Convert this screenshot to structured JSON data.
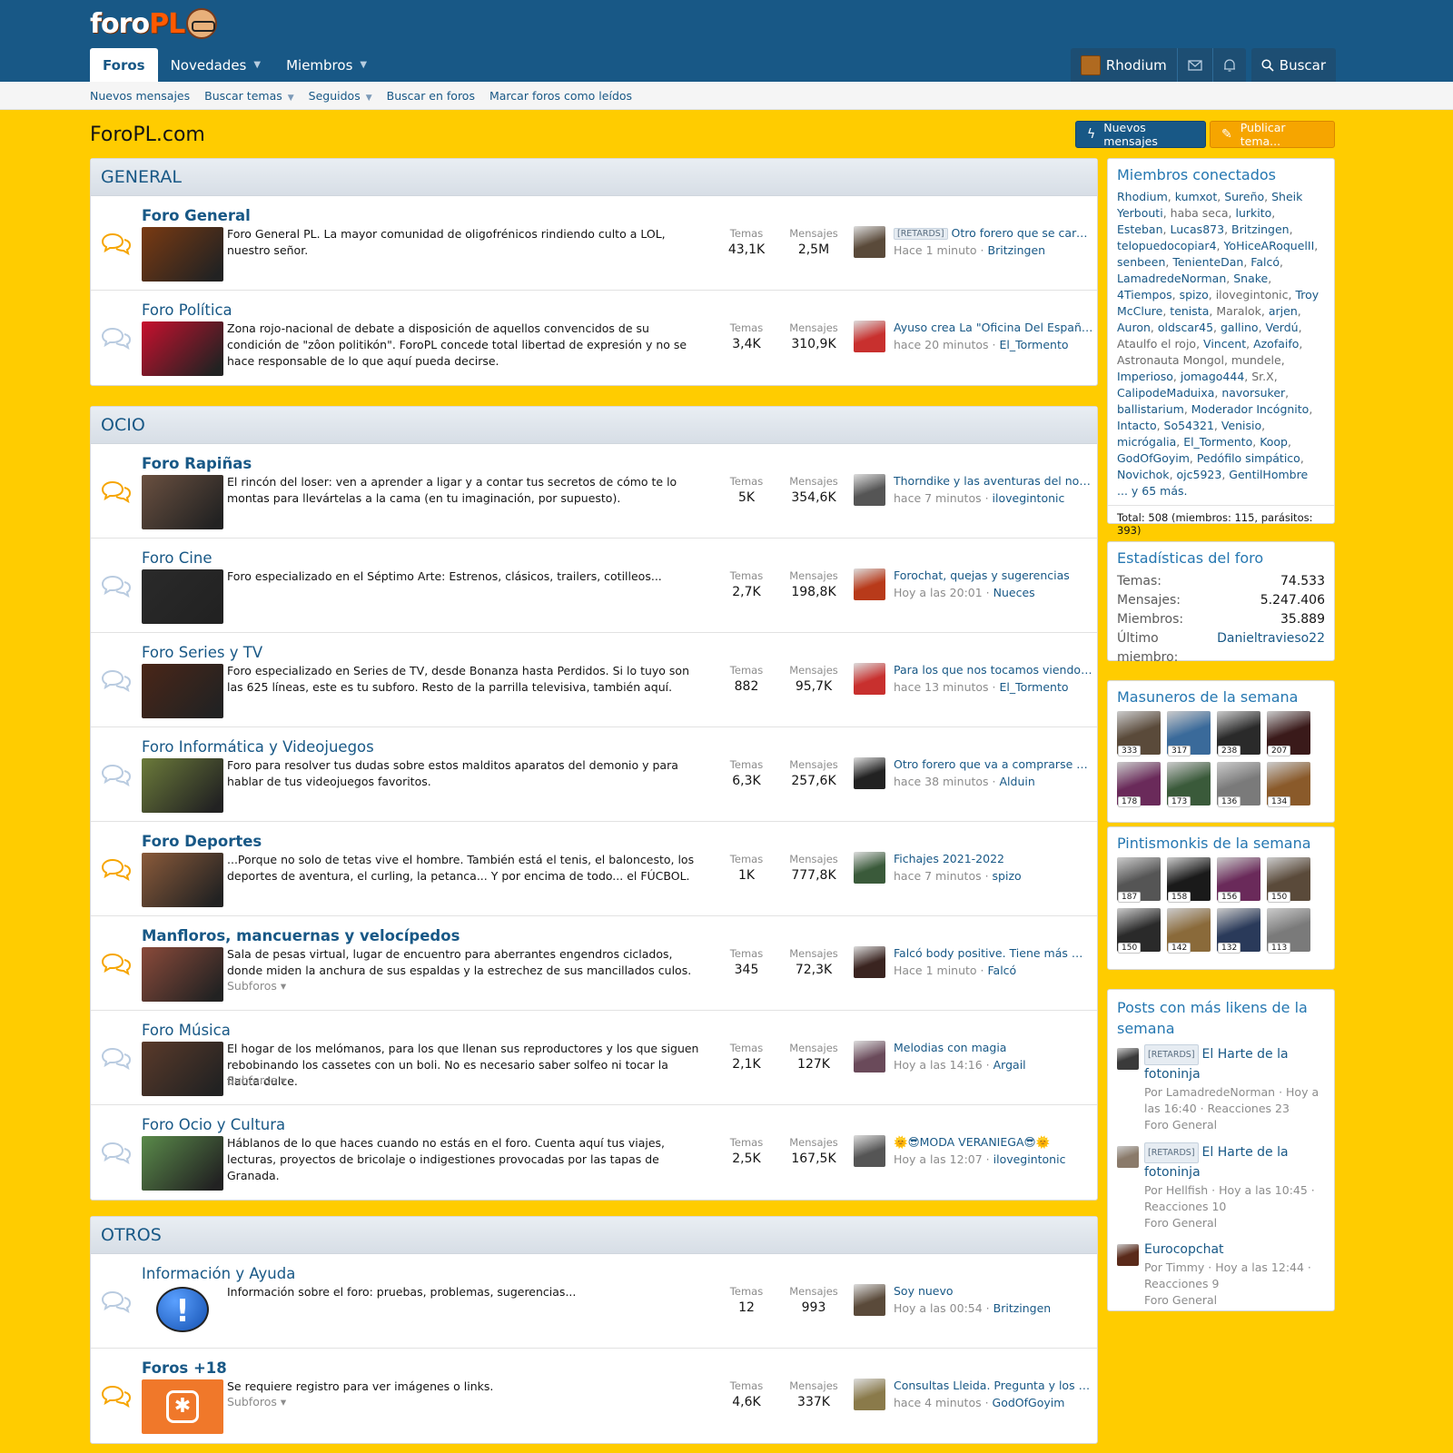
{
  "logo": {
    "part1": "foro",
    "part2": "PL"
  },
  "nav": {
    "tabs": [
      {
        "label": "Foros",
        "active": true
      },
      {
        "label": "Novedades",
        "caret": true
      },
      {
        "label": "Miembros",
        "caret": true
      }
    ],
    "user": "Rhodium",
    "search_label": "Buscar"
  },
  "subnav": [
    "Nuevos mensajes",
    "Buscar temas",
    "Seguidos",
    "Buscar en foros",
    "Marcar foros como leídos"
  ],
  "page_title": "ForoPL.com",
  "buttons": {
    "new_posts": "Nuevos mensajes",
    "post_thread": "Publicar tema..."
  },
  "labels": {
    "threads": "Temas",
    "messages": "Mensajes",
    "subforums": "Subforos"
  },
  "categories": [
    {
      "title": "GENERAL",
      "nodes": [
        {
          "name": "Foro General",
          "unread": true,
          "thumb": "#7a3a12",
          "desc": "Foro General PL. La mayor comunidad de oligofrénicos rindiendo culto a LOL, nuestro señor.",
          "threads": "43,1K",
          "messages": "2,5M",
          "last_prefix": "[RETARDS]",
          "last_title": "Otro forero que se carga en el hilo para",
          "last_time": "Hace 1 minuto",
          "last_user": "Britzingen",
          "last_av": "#5a4a3a"
        },
        {
          "name": "Foro Política",
          "unread": false,
          "thumb": "#c8102e",
          "desc": "Zona rojo-nacional de debate a disposición de aquellos convencidos de su condición de \"zôon politikón\". ForoPL concede total libertad de expresión y no se hace responsable de lo que aquí pueda decirse.",
          "threads": "3,4K",
          "messages": "310,9K",
          "last_prefix": "",
          "last_title": "Ayuso crea La \"Oficina Del Español\" para",
          "last_time": "hace 20 minutos",
          "last_user": "El_Tormento",
          "last_av": "#c8302e"
        }
      ]
    },
    {
      "title": "OCIO",
      "nodes": [
        {
          "name": "Foro Rapiñas",
          "unread": true,
          "thumb": "#6a5040",
          "desc": "El rincón del loser: ven a aprender a ligar y a contar tus secretos de cómo te lo montas para llevártelas a la cama (en tu imaginación, por supuesto).",
          "threads": "5K",
          "messages": "354,6K",
          "last_prefix": "",
          "last_title": "Thorndike y las aventuras del no pasa nada",
          "last_time": "hace 7 minutos",
          "last_user": "ilovegintonic",
          "last_av": "#555555"
        },
        {
          "name": "Foro Cine",
          "unread": false,
          "thumb": "#2a2a2a",
          "desc": "Foro especializado en el Séptimo Arte: Estrenos, clásicos, trailers, cotilleos...",
          "threads": "2,7K",
          "messages": "198,8K",
          "last_prefix": "",
          "last_title": "Forochat, quejas y sugerencias",
          "last_time": "Hoy a las 20:01",
          "last_user": "Nueces",
          "last_av": "#b83a1a"
        },
        {
          "name": "Foro Series y TV",
          "unread": false,
          "thumb": "#4a2618",
          "desc": "Foro especializado en Series de TV, desde Bonanza hasta Perdidos. Si lo tuyo son las 625 líneas, este es tu subforo. Resto de la parrilla televisiva, también aquí.",
          "threads": "882",
          "messages": "95,7K",
          "last_prefix": "",
          "last_title": "Para los que nos tocamos viendo digimon",
          "last_time": "hace 13 minutos",
          "last_user": "El_Tormento",
          "last_av": "#c8302e"
        },
        {
          "name": "Foro Informática y Videojuegos",
          "unread": false,
          "thumb": "#6b7a3a",
          "desc": "Foro para resolver tus dudas sobre estos malditos aparatos del demonio y para hablar de tus videojuegos favoritos.",
          "threads": "6,3K",
          "messages": "257,6K",
          "last_prefix": "",
          "last_title": "Otro forero que va a comprarse un PC",
          "last_time": "hace 38 minutos",
          "last_user": "Alduin",
          "last_av": "#222222"
        },
        {
          "name": "Foro Deportes",
          "unread": true,
          "thumb": "#8a5a3a",
          "desc": "...Porque no solo de tetas vive el hombre. También está el tenis, el baloncesto, los deportes de aventura, el curling, la petanca... Y por encima de todo... el FÚCBOL.",
          "threads": "1K",
          "messages": "777,8K",
          "last_prefix": "",
          "last_title": "Fichajes 2021-2022",
          "last_time": "hace 7 minutos",
          "last_user": "spizo",
          "last_av": "#3a5a3a"
        },
        {
          "name": "Manfloros, mancuernas y velocípedos",
          "unread": true,
          "thumb": "#8a4a3a",
          "desc": "Sala de pesas virtual, lugar de encuentro para aberrantes engendros ciclados, donde miden la anchura de sus espaldas y la estrechez de sus mancillados culos.",
          "threads": "345",
          "messages": "72,3K",
          "subforos": true,
          "last_prefix": "",
          "last_title": "Falcó body positive. Tiene más mortales que",
          "last_time": "Hace 1 minuto",
          "last_user": "Falcó",
          "last_av": "#3a2420"
        },
        {
          "name": "Foro Música",
          "unread": false,
          "thumb": "#5a3a2a",
          "desc": "El hogar de los melómanos, para los que llenan sus reproductores y los que siguen rebobinando los cassetes con un boli. No es necesario saber solfeo ni tocar la flauta dulce.",
          "threads": "2,1K",
          "messages": "127K",
          "subforos": true,
          "last_prefix": "",
          "last_title": "Melodias con magia",
          "last_time": "Hoy a las 14:16",
          "last_user": "Argail",
          "last_av": "#6a4a5a"
        },
        {
          "name": "Foro Ocio y Cultura",
          "unread": false,
          "thumb": "#5a8a4a",
          "desc": "Háblanos de lo que haces cuando no estás en el foro. Cuenta aquí tus viajes, lecturas, proyectos de bricolaje o indigestiones provocadas por las tapas de Granada.",
          "threads": "2,5K",
          "messages": "167,5K",
          "last_prefix": "",
          "last_title": "🌞😎MODA VERANIEGA😎🌞",
          "last_time": "Hoy a las 12:07",
          "last_user": "ilovegintonic",
          "last_av": "#555555"
        }
      ]
    },
    {
      "title": "OTROS",
      "nodes": [
        {
          "name": "Información y Ayuda",
          "unread": false,
          "thumb": "#ffcc00",
          "thumb_icon": "!",
          "desc": "Información sobre el foro: pruebas, problemas, sugerencias...",
          "threads": "12",
          "messages": "993",
          "last_prefix": "",
          "last_title": "Soy nuevo",
          "last_time": "Hoy a las 00:54",
          "last_user": "Britzingen",
          "last_av": "#5a4a3a"
        },
        {
          "name": "Foros +18",
          "unread": true,
          "thumb": "#f0782a",
          "desc": "Se requiere registro para ver imágenes o links.",
          "threads": "4,6K",
          "messages": "337K",
          "subforos": true,
          "last_prefix": "",
          "last_title": "Consultas Lleida. Pregunta y los foreros",
          "last_time": "hace 4 minutos",
          "last_user": "GodOfGoyim",
          "last_av": "#8a7a4a"
        }
      ]
    }
  ],
  "online": {
    "title": "Miembros conectados",
    "members": [
      {
        "n": "Rhodium",
        "g": false
      },
      {
        "n": "kumxot",
        "g": false
      },
      {
        "n": "Sureño",
        "g": false
      },
      {
        "n": "Sheik Yerbouti",
        "g": false
      },
      {
        "n": "haba seca",
        "g": true
      },
      {
        "n": "lurkito",
        "g": false
      },
      {
        "n": "Esteban",
        "g": false
      },
      {
        "n": "Lucas873",
        "g": false
      },
      {
        "n": "Britzingen",
        "g": false
      },
      {
        "n": "telopuedocopiar4",
        "g": false
      },
      {
        "n": "YoHiceARoquelII",
        "g": false
      },
      {
        "n": "senbeen",
        "g": false
      },
      {
        "n": "TenienteDan",
        "g": false
      },
      {
        "n": "Falcó",
        "g": false
      },
      {
        "n": "LamadredeNorman",
        "g": false
      },
      {
        "n": "Snake",
        "g": false
      },
      {
        "n": "4Tiempos",
        "g": false
      },
      {
        "n": "spizo",
        "g": false
      },
      {
        "n": "ilovegintonic",
        "g": true
      },
      {
        "n": "Troy McClure",
        "g": false
      },
      {
        "n": "tenista",
        "g": false
      },
      {
        "n": "Maralok",
        "g": true
      },
      {
        "n": "arjen",
        "g": false
      },
      {
        "n": "Auron",
        "g": false
      },
      {
        "n": "oldscar45",
        "g": false
      },
      {
        "n": "gallino",
        "g": false
      },
      {
        "n": "Verdú",
        "g": false
      },
      {
        "n": "Ataulfo el rojo",
        "g": true
      },
      {
        "n": "Vincent",
        "g": false
      },
      {
        "n": "Azofaifo",
        "g": false
      },
      {
        "n": "Astronauta Mongol",
        "g": true
      },
      {
        "n": "mundele",
        "g": true
      },
      {
        "n": "Imperioso",
        "g": false
      },
      {
        "n": "jomago444",
        "g": false
      },
      {
        "n": "Sr.X",
        "g": true
      },
      {
        "n": "CalipodeMaduixa",
        "g": false
      },
      {
        "n": "navorsuker",
        "g": false
      },
      {
        "n": "ballistarium",
        "g": false
      },
      {
        "n": "Moderador Incógnito",
        "g": false
      },
      {
        "n": "Intacto",
        "g": false
      },
      {
        "n": "So54321",
        "g": false
      },
      {
        "n": "Venisio",
        "g": false
      },
      {
        "n": "micrógalia",
        "g": false
      },
      {
        "n": "El_Tormento",
        "g": false
      },
      {
        "n": "Koop",
        "g": false
      },
      {
        "n": "GodOfGoyim",
        "g": false
      },
      {
        "n": "Pedófilo simpático",
        "g": false
      },
      {
        "n": "Novichok",
        "g": false
      },
      {
        "n": "ojc5923",
        "g": false
      },
      {
        "n": "GentilHombre",
        "g": false
      }
    ],
    "more": "... y 65 más.",
    "total": "Total: 508 (miembros: 115, parásitos: 393)"
  },
  "forum_stats": {
    "title": "Estadísticas del foro",
    "rows": [
      {
        "k": "Temas:",
        "v": "74.533"
      },
      {
        "k": "Mensajes:",
        "v": "5.247.406"
      },
      {
        "k": "Miembros:",
        "v": "35.889"
      },
      {
        "k": "Último miembro:",
        "v": "Danieltravieso22",
        "link": true
      }
    ]
  },
  "masuneros": {
    "title": "Masuneros de la semana",
    "items": [
      {
        "n": "333",
        "c": "#5a4a3a"
      },
      {
        "n": "317",
        "c": "#3a6a9a"
      },
      {
        "n": "238",
        "c": "#2a2a2a"
      },
      {
        "n": "207",
        "c": "#3a1a1a"
      },
      {
        "n": "178",
        "c": "#6a2a5a"
      },
      {
        "n": "173",
        "c": "#3a5a3a"
      },
      {
        "n": "136",
        "c": "#7a7a7a"
      },
      {
        "n": "134",
        "c": "#8a5a2a"
      }
    ]
  },
  "pintismonkis": {
    "title": "Pintismonkis de la semana",
    "items": [
      {
        "n": "187",
        "c": "#555555"
      },
      {
        "n": "158",
        "c": "#1a1a1a"
      },
      {
        "n": "156",
        "c": "#6a2a5a"
      },
      {
        "n": "150",
        "c": "#5a4a3a"
      },
      {
        "n": "150",
        "c": "#2a2a2a"
      },
      {
        "n": "142",
        "c": "#8a6a3a"
      },
      {
        "n": "132",
        "c": "#2a3a5a"
      },
      {
        "n": "113",
        "c": "#7a7a7a"
      }
    ]
  },
  "top_posts": {
    "title": "Posts con más likens de la semana",
    "items": [
      {
        "prefix": "[RETARDS]",
        "title": "El Harte de la fotoninja",
        "meta": "Por LamadredeNorman · Hoy a las 16:40 · Reacciones 23",
        "forum": "Foro General",
        "c": "#3a3a3a"
      },
      {
        "prefix": "[RETARDS]",
        "title": "El Harte de la fotoninja",
        "meta": "Por Hellfish · Hoy a las 10:45 · Reacciones 10",
        "forum": "Foro General",
        "c": "#8a7a6a"
      },
      {
        "prefix": "",
        "title": "Eurocopchat",
        "meta": "Por Timmy · Hoy a las 12:44 · Reacciones 9",
        "forum": "Foro General",
        "c": "#5a2a1a"
      }
    ]
  }
}
